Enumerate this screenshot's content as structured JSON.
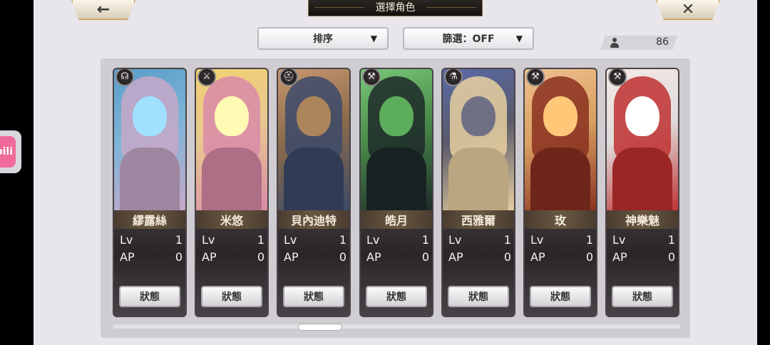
{
  "header": {
    "title": "選擇角色",
    "back_icon": "←",
    "close_icon": "✕"
  },
  "controls": {
    "sort_label": "排序",
    "filter_label": "篩選：OFF",
    "caret": "▼"
  },
  "counter": {
    "value": "86"
  },
  "side_app": {
    "label": "bili"
  },
  "characters": [
    {
      "name": "繆露絲",
      "lv_label": "Lv",
      "lv": "1",
      "ap_label": "AP",
      "ap": "0",
      "status_label": "狀態",
      "weapon_icon": "☊",
      "art_colors": [
        "#7fb4d8",
        "#c7a8c8",
        "#5a9ec8"
      ]
    },
    {
      "name": "米悠",
      "lv_label": "Lv",
      "lv": "1",
      "ap_label": "AP",
      "ap": "0",
      "status_label": "狀態",
      "weapon_icon": "⚔",
      "art_colors": [
        "#e8c890",
        "#d98aa8",
        "#f0d070"
      ]
    },
    {
      "name": "貝內迪特",
      "lv_label": "Lv",
      "lv": "1",
      "ap_label": "AP",
      "ap": "0",
      "status_label": "狀態",
      "weapon_icon": "⛑",
      "art_colors": [
        "#8a6a4a",
        "#3c4a6a",
        "#c89870"
      ]
    },
    {
      "name": "皓月",
      "lv_label": "Lv",
      "lv": "1",
      "ap_label": "AP",
      "ap": "0",
      "status_label": "狀態",
      "weapon_icon": "⚒",
      "art_colors": [
        "#4a8a4a",
        "#1e2a2a",
        "#78c878"
      ]
    },
    {
      "name": "西雅爾",
      "lv_label": "Lv",
      "lv": "1",
      "ap_label": "AP",
      "ap": "0",
      "status_label": "狀態",
      "weapon_icon": "⚗",
      "art_colors": [
        "#5a5a6a",
        "#e8d0a0",
        "#5a6aa8"
      ]
    },
    {
      "name": "玫",
      "lv_label": "Lv",
      "lv": "1",
      "ap_label": "AP",
      "ap": "0",
      "status_label": "狀態",
      "weapon_icon": "⚒",
      "art_colors": [
        "#d8a060",
        "#8a3020",
        "#f0c090"
      ]
    },
    {
      "name": "神樂魅",
      "lv_label": "Lv",
      "lv": "1",
      "ap_label": "AP",
      "ap": "0",
      "status_label": "狀態",
      "weapon_icon": "⚒",
      "art_colors": [
        "#e0dcdc",
        "#c03030",
        "#f4e8e4"
      ]
    }
  ]
}
